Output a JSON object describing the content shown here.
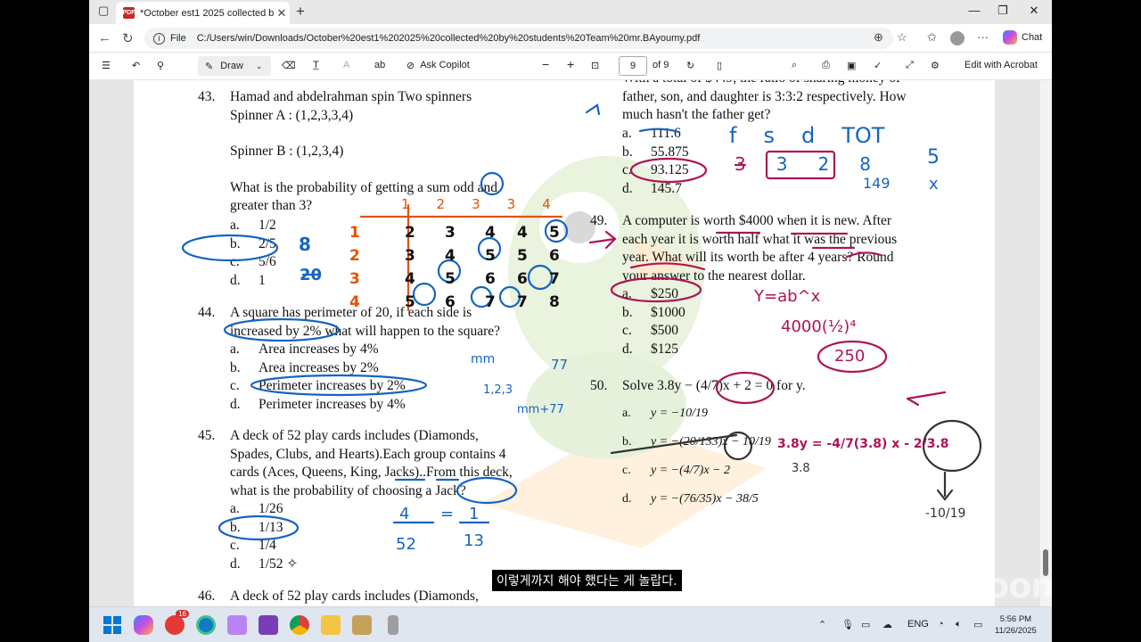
{
  "browser": {
    "tab_title": "*October est1 2025 collected by s",
    "tab_close": "✕",
    "new_tab": "+",
    "minimize": "—",
    "restore": "❐",
    "close": "✕",
    "file_label": "File",
    "url": "C:/Users/win/Downloads/October%20est1%202025%20collected%20by%20students%20Team%20mr.BAyoumy.pdf",
    "chat_label": "Chat",
    "more": "···"
  },
  "toolbar": {
    "draw_label": "Draw",
    "ask_copilot_label": "Ask Copilot",
    "page_current": "9",
    "page_total": "of 9",
    "edit_acrobat_label": "Edit with Acrobat",
    "zoom_out": "−",
    "zoom_in": "+"
  },
  "document": {
    "q43": {
      "num": "43.",
      "line1": "Hamad and abdelrahman spin Two spinners",
      "line2": "Spinner A : (1,2,3,3,4)",
      "line3": "Spinner B : (1,2,3,4)",
      "line4": "What is the probability of getting a sum odd and",
      "line5": "greater than 3?",
      "options": [
        {
          "letter": "a.",
          "text": "1/2"
        },
        {
          "letter": "b.",
          "text": "2/5"
        },
        {
          "letter": "c.",
          "text": "5/6"
        },
        {
          "letter": "d.",
          "text": "1"
        }
      ]
    },
    "q44": {
      "num": "44.",
      "line1": "A square has perimeter of 20, if each side is",
      "line2a": "increased by 2%",
      "line2b": "what will happen to the square?",
      "options": [
        {
          "letter": "a.",
          "text": "Area increases by 4%"
        },
        {
          "letter": "b.",
          "text": "Area increases by 2%"
        },
        {
          "letter": "c.",
          "text": "Perimeter increases by 2%"
        },
        {
          "letter": "d.",
          "text": "Perimeter increases by 4%"
        }
      ]
    },
    "q45": {
      "num": "45.",
      "line1": "A deck of 52 play cards includes (Diamonds,",
      "line2": "Spades, Clubs, and Hearts).Each group contains 4",
      "line3": "cards (Aces, Queens, King, Jacks)..From this deck,",
      "line4": "what is the probability of choosing a Jack?",
      "options": [
        {
          "letter": "a.",
          "text": "1/26"
        },
        {
          "letter": "b.",
          "text": "1/13"
        },
        {
          "letter": "c.",
          "text": "1/4"
        },
        {
          "letter": "d.",
          "text": "1/52 ✧"
        }
      ]
    },
    "q46": {
      "num": "46.",
      "line1": "A deck of 52 play cards includes (Diamonds,"
    },
    "q48": {
      "line0": "With a total of $449, the ratio of sharing money of",
      "line1": "father, son, and daughter is 3:3:2 respectively. How",
      "line2": "much hasn't the father get?",
      "options": [
        {
          "letter": "a.",
          "text": "111.6"
        },
        {
          "letter": "b.",
          "text": "55.875"
        },
        {
          "letter": "c.",
          "text": "93.125"
        },
        {
          "letter": "d.",
          "text": "145.7"
        }
      ]
    },
    "q49": {
      "num": "49.",
      "line1": "A computer is worth $4000 when it is new. After",
      "line2": "each year it is worth half what it was the previous",
      "line3": "year. What will its worth be after 4 years? Round",
      "line4": "your answer to the nearest dollar.",
      "options": [
        {
          "letter": "a.",
          "text": "$250"
        },
        {
          "letter": "b.",
          "text": "$1000"
        },
        {
          "letter": "c.",
          "text": "$500"
        },
        {
          "letter": "d.",
          "text": "$125"
        }
      ]
    },
    "q50": {
      "num": "50.",
      "line1": "Solve 3.8y − (4/7)x + 2 = 0 for y.",
      "options": [
        {
          "letter": "a.",
          "text": "y = −10/19"
        },
        {
          "letter": "b.",
          "text": "y = −(20/133)x − 10/19"
        },
        {
          "letter": "c.",
          "text": "y = −(4/7)x − 2"
        },
        {
          "letter": "d.",
          "text": "y = −(76/35)x − 38/5"
        }
      ]
    },
    "handwriting": {
      "prob43_b": "8",
      "prob43_d": "20",
      "table_header": [
        "1",
        "2",
        "3",
        "3",
        "4"
      ],
      "table_rows": [
        {
          "label": "1",
          "cells": [
            "2",
            "3",
            "4",
            "4",
            "5"
          ]
        },
        {
          "label": "2",
          "cells": [
            "3",
            "4",
            "5",
            "5",
            "6"
          ]
        },
        {
          "label": "3",
          "cells": [
            "4",
            "5",
            "6",
            "6",
            "7"
          ]
        },
        {
          "label": "4",
          "cells": [
            "5",
            "6",
            "7",
            "7",
            "8"
          ]
        }
      ],
      "note44a": "mm",
      "note44b": "77",
      "note44c": "1,2,3",
      "note44d": "mm+77",
      "frac45_top_left": "4",
      "frac45_bottom_left": "52",
      "frac45_top_right": "1",
      "frac45_bottom_right": "13",
      "ratio_labels": [
        "f",
        "s",
        "d",
        "TOT"
      ],
      "ratio_vals": [
        "3",
        "3",
        "2",
        "8"
      ],
      "ratio_total": "149",
      "ratio_5": "5",
      "ratio_x": "x",
      "formula49": "Y=ab^x",
      "calc49": "4000(½)⁴",
      "ans49": "250",
      "work50_a": "3.8y = -4/7(3.8) x - 2/3.8",
      "work50_b": "3.8",
      "work50_c": "-10/19"
    }
  },
  "subtitle": "이렇게까지 해야 했다는 게 놀랍다.",
  "zoom_logo": "zoom",
  "taskbar": {
    "badge": "16",
    "lang": "ENG",
    "time": "5:56 PM",
    "date": "11/26/2025"
  }
}
